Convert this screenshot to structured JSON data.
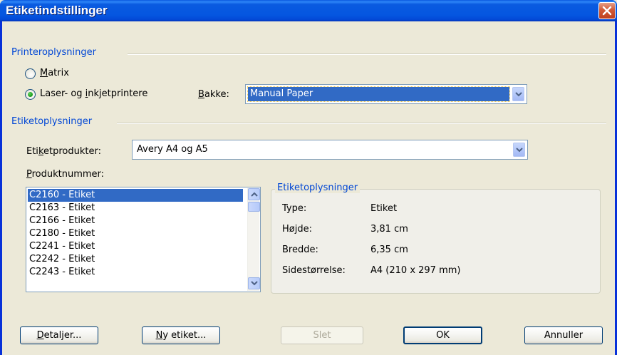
{
  "window": {
    "title": "Etiketindstillinger"
  },
  "printer_group": {
    "title": "Printeroplysninger",
    "radio_matrix": {
      "pre": "",
      "key": "M",
      "post": "atrix"
    },
    "radio_laser": {
      "pre": "Laser- og ",
      "key": "i",
      "post": "nkjetprintere"
    },
    "tray_label": {
      "pre": "",
      "key": "B",
      "post": "akke:"
    },
    "tray_value": "Manual Paper"
  },
  "label_group": {
    "title": "Etiketoplysninger",
    "vendor_label": {
      "pre": "Eti",
      "key": "k",
      "post": "etprodukter:"
    },
    "vendor_value": "Avery A4 og A5",
    "product_label": {
      "pre": "",
      "key": "P",
      "post": "roduktnummer:"
    },
    "products": [
      "C2160 - Etiket",
      "C2163 - Etiket",
      "C2166 - Etiket",
      "C2180 - Etiket",
      "C2241 - Etiket",
      "C2242 - Etiket",
      "C2243 - Etiket"
    ]
  },
  "info": {
    "title": "Etiketoplysninger",
    "rows": [
      {
        "label": "Type:",
        "value": "Etiket"
      },
      {
        "label": "Højde:",
        "value": "3,81 cm"
      },
      {
        "label": "Bredde:",
        "value": "6,35 cm"
      },
      {
        "label": "Sidestørrelse:",
        "value": "A4 (210 x 297 mm)"
      }
    ]
  },
  "buttons": {
    "details": {
      "pre": "",
      "key": "D",
      "post": "etaljer..."
    },
    "new_label": {
      "pre": "",
      "key": "N",
      "post": "y etiket..."
    },
    "delete": "Slet",
    "ok": "OK",
    "cancel": "Annuller"
  },
  "colors": {
    "titlebar": "#0556e0",
    "group_title": "#0046d5",
    "selection": "#316ac5",
    "close_button": "#c0401e"
  },
  "icons": [
    "close-icon",
    "chevron-down-icon",
    "chevron-up-icon"
  ]
}
